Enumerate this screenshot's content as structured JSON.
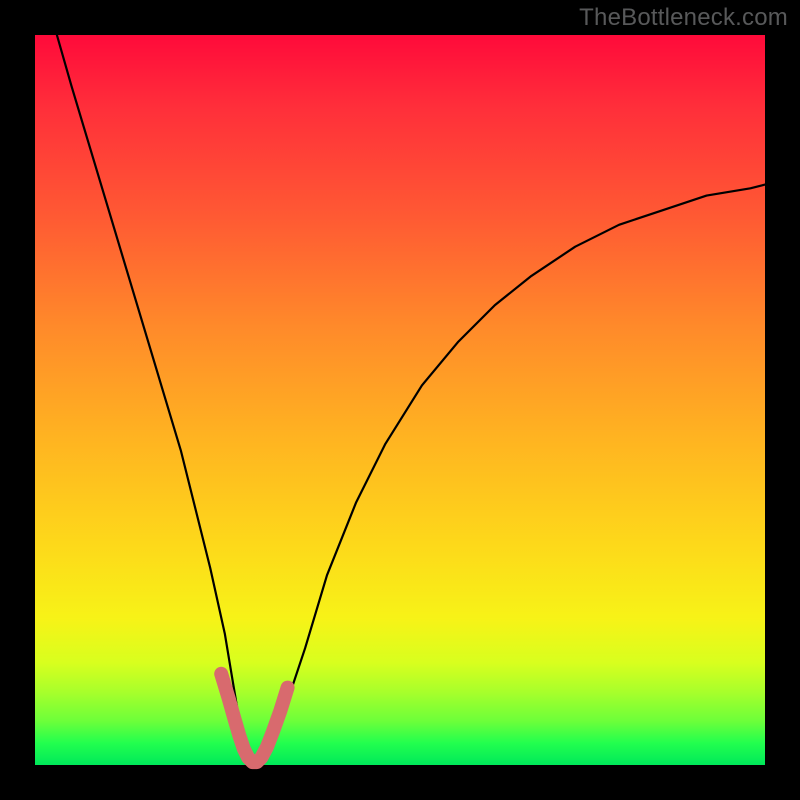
{
  "watermark": "TheBottleneck.com",
  "chart_data": {
    "type": "line",
    "title": "",
    "xlabel": "",
    "ylabel": "",
    "xlim": [
      0,
      100
    ],
    "ylim": [
      0,
      100
    ],
    "series": [
      {
        "name": "curve",
        "color": "#000000",
        "x": [
          3,
          5,
          8,
          11,
          14,
          17,
          20,
          22,
          24,
          26,
          27,
          28,
          29,
          30,
          31,
          32,
          34,
          37,
          40,
          44,
          48,
          53,
          58,
          63,
          68,
          74,
          80,
          86,
          92,
          98,
          100
        ],
        "y": [
          100,
          93,
          83,
          73,
          63,
          53,
          43,
          35,
          27,
          18,
          12,
          6,
          2,
          0,
          0,
          2,
          7,
          16,
          26,
          36,
          44,
          52,
          58,
          63,
          67,
          71,
          74,
          76,
          78,
          79,
          79.5
        ]
      },
      {
        "name": "trough-highlight",
        "color": "#d86a6e",
        "x": [
          25.5,
          26.5,
          27.3,
          28.0,
          28.6,
          29.2,
          29.8,
          30.4,
          31.0,
          31.8,
          32.6,
          33.6,
          34.6
        ],
        "y": [
          12.5,
          9.2,
          6.4,
          4.0,
          2.2,
          1.0,
          0.4,
          0.4,
          1.0,
          2.5,
          4.6,
          7.4,
          10.6
        ]
      }
    ]
  },
  "colors": {
    "background": "#000000",
    "gradient_top": "#ff0a3a",
    "gradient_bottom": "#00e85a",
    "curve": "#000000",
    "highlight": "#d86a6e",
    "watermark": "#58595a"
  }
}
